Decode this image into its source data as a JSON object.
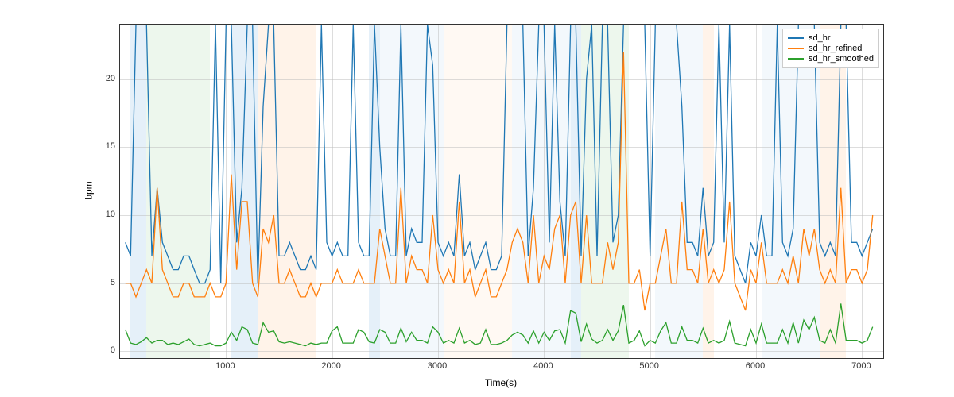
{
  "chart_data": {
    "type": "line",
    "xlabel": "Time(s)",
    "ylabel": "bpm",
    "xlim": [
      0,
      7200
    ],
    "ylim": [
      -0.5,
      24
    ],
    "xticks": [
      1000,
      2000,
      3000,
      4000,
      5000,
      6000,
      7000
    ],
    "yticks": [
      0,
      5,
      10,
      15,
      20
    ],
    "legend": [
      "sd_hr",
      "sd_hr_refined",
      "sd_hr_smoothed"
    ],
    "colors": {
      "sd_hr": "#1f77b4",
      "sd_hr_refined": "#ff7f0e",
      "sd_hr_smoothed": "#2ca02c"
    },
    "bands": [
      {
        "x0": 100,
        "x1": 250,
        "color": "#99c2e6"
      },
      {
        "x0": 250,
        "x1": 850,
        "color": "#b8e0b8"
      },
      {
        "x0": 1050,
        "x1": 1300,
        "color": "#99c2e6"
      },
      {
        "x0": 1300,
        "x1": 1850,
        "color": "#ffd0a8"
      },
      {
        "x0": 2350,
        "x1": 2450,
        "color": "#99c2e6"
      },
      {
        "x0": 2450,
        "x1": 3050,
        "color": "#cfe3f5"
      },
      {
        "x0": 3050,
        "x1": 3700,
        "color": "#ffe6d0"
      },
      {
        "x0": 3700,
        "x1": 4250,
        "color": "#cfe3f5"
      },
      {
        "x0": 4250,
        "x1": 4350,
        "color": "#99c2e6"
      },
      {
        "x0": 4350,
        "x1": 4800,
        "color": "#b8e0b8"
      },
      {
        "x0": 5050,
        "x1": 5500,
        "color": "#cfe3f5"
      },
      {
        "x0": 5500,
        "x1": 5600,
        "color": "#ffd0a8"
      },
      {
        "x0": 6050,
        "x1": 6600,
        "color": "#cfe3f5"
      },
      {
        "x0": 6600,
        "x1": 6850,
        "color": "#ffd0a8"
      }
    ],
    "series": [
      {
        "name": "sd_hr",
        "x": [
          50,
          100,
          150,
          200,
          250,
          300,
          350,
          400,
          450,
          500,
          550,
          600,
          650,
          700,
          750,
          800,
          850,
          900,
          950,
          1000,
          1050,
          1100,
          1150,
          1200,
          1250,
          1300,
          1350,
          1400,
          1450,
          1500,
          1550,
          1600,
          1650,
          1700,
          1750,
          1800,
          1850,
          1900,
          1950,
          2000,
          2050,
          2100,
          2150,
          2200,
          2250,
          2300,
          2350,
          2400,
          2450,
          2500,
          2550,
          2600,
          2650,
          2700,
          2750,
          2800,
          2850,
          2900,
          2950,
          3000,
          3050,
          3100,
          3150,
          3200,
          3250,
          3300,
          3350,
          3400,
          3450,
          3500,
          3550,
          3600,
          3650,
          3700,
          3750,
          3800,
          3850,
          3900,
          3950,
          4000,
          4050,
          4100,
          4150,
          4200,
          4250,
          4300,
          4350,
          4400,
          4450,
          4500,
          4550,
          4600,
          4650,
          4700,
          4750,
          4800,
          4850,
          4900,
          4950,
          5000,
          5050,
          5100,
          5150,
          5200,
          5250,
          5300,
          5350,
          5400,
          5450,
          5500,
          5550,
          5600,
          5650,
          5700,
          5750,
          5800,
          5850,
          5900,
          5950,
          6000,
          6050,
          6100,
          6150,
          6200,
          6250,
          6300,
          6350,
          6400,
          6450,
          6500,
          6550,
          6600,
          6650,
          6700,
          6750,
          6800,
          6850,
          6900,
          6950,
          7000,
          7050,
          7100
        ],
        "y": [
          8,
          7,
          24,
          24,
          24,
          7,
          12,
          8,
          7,
          6,
          6,
          7,
          7,
          6,
          5,
          5,
          6,
          24,
          5,
          24,
          24,
          8,
          12,
          24,
          24,
          5,
          18,
          24,
          24,
          7,
          7,
          8,
          7,
          6,
          6,
          7,
          6,
          24,
          8,
          7,
          8,
          7,
          7,
          24,
          8,
          7,
          7,
          24,
          15,
          9,
          7,
          7,
          24,
          7,
          9,
          8,
          8,
          24,
          21,
          8,
          7,
          8,
          7,
          13,
          7,
          8,
          6,
          7,
          8,
          6,
          6,
          7,
          24,
          24,
          24,
          24,
          7,
          12,
          24,
          24,
          8,
          24,
          11,
          7,
          24,
          24,
          7,
          20,
          24,
          7,
          24,
          24,
          8,
          10,
          24,
          24,
          24,
          24,
          24,
          7,
          24,
          24,
          24,
          24,
          24,
          18,
          8,
          8,
          7,
          12,
          7,
          8,
          24,
          8,
          24,
          7,
          6,
          5,
          8,
          7,
          10,
          7,
          7,
          24,
          8,
          7,
          9,
          24,
          24,
          24,
          24,
          8,
          7,
          8,
          7,
          24,
          24,
          8,
          8,
          7,
          8,
          9
        ]
      },
      {
        "name": "sd_hr_refined",
        "x": [
          50,
          100,
          150,
          200,
          250,
          300,
          350,
          400,
          450,
          500,
          550,
          600,
          650,
          700,
          750,
          800,
          850,
          900,
          950,
          1000,
          1050,
          1100,
          1150,
          1200,
          1250,
          1300,
          1350,
          1400,
          1450,
          1500,
          1550,
          1600,
          1650,
          1700,
          1750,
          1800,
          1850,
          1900,
          1950,
          2000,
          2050,
          2100,
          2150,
          2200,
          2250,
          2300,
          2350,
          2400,
          2450,
          2500,
          2550,
          2600,
          2650,
          2700,
          2750,
          2800,
          2850,
          2900,
          2950,
          3000,
          3050,
          3100,
          3150,
          3200,
          3250,
          3300,
          3350,
          3400,
          3450,
          3500,
          3550,
          3600,
          3650,
          3700,
          3750,
          3800,
          3850,
          3900,
          3950,
          4000,
          4050,
          4100,
          4150,
          4200,
          4250,
          4300,
          4350,
          4400,
          4450,
          4500,
          4550,
          4600,
          4650,
          4700,
          4750,
          4800,
          4850,
          4900,
          4950,
          5000,
          5050,
          5100,
          5150,
          5200,
          5250,
          5300,
          5350,
          5400,
          5450,
          5500,
          5550,
          5600,
          5650,
          5700,
          5750,
          5800,
          5850,
          5900,
          5950,
          6000,
          6050,
          6100,
          6150,
          6200,
          6250,
          6300,
          6350,
          6400,
          6450,
          6500,
          6550,
          6600,
          6650,
          6700,
          6750,
          6800,
          6850,
          6900,
          6950,
          7000,
          7050,
          7100
        ],
        "y": [
          5,
          5,
          4,
          5,
          6,
          5,
          12,
          6,
          5,
          4,
          4,
          5,
          5,
          4,
          4,
          4,
          5,
          4,
          4,
          5,
          13,
          6,
          11,
          11,
          5,
          4,
          9,
          8,
          10,
          5,
          5,
          6,
          5,
          4,
          4,
          5,
          4,
          5,
          5,
          5,
          6,
          5,
          5,
          5,
          6,
          5,
          5,
          5,
          9,
          7,
          5,
          5,
          12,
          5,
          7,
          6,
          6,
          5,
          10,
          6,
          5,
          6,
          5,
          11,
          5,
          6,
          4,
          5,
          6,
          4,
          4,
          5,
          6,
          8,
          9,
          8,
          5,
          10,
          5,
          7,
          6,
          9,
          10,
          5,
          10,
          11,
          5,
          10,
          5,
          5,
          5,
          8,
          6,
          8,
          22,
          5,
          5,
          6,
          3,
          5,
          5,
          7,
          9,
          5,
          5,
          11,
          6,
          6,
          5,
          9,
          5,
          6,
          5,
          6,
          11,
          5,
          4,
          3,
          6,
          5,
          8,
          5,
          5,
          5,
          6,
          5,
          7,
          5,
          9,
          7,
          9,
          6,
          5,
          6,
          5,
          12,
          5,
          6,
          6,
          5,
          6,
          10
        ]
      },
      {
        "name": "sd_hr_smoothed",
        "x": [
          50,
          100,
          150,
          200,
          250,
          300,
          350,
          400,
          450,
          500,
          550,
          600,
          650,
          700,
          750,
          800,
          850,
          900,
          950,
          1000,
          1050,
          1100,
          1150,
          1200,
          1250,
          1300,
          1350,
          1400,
          1450,
          1500,
          1550,
          1600,
          1650,
          1700,
          1750,
          1800,
          1850,
          1900,
          1950,
          2000,
          2050,
          2100,
          2150,
          2200,
          2250,
          2300,
          2350,
          2400,
          2450,
          2500,
          2550,
          2600,
          2650,
          2700,
          2750,
          2800,
          2850,
          2900,
          2950,
          3000,
          3050,
          3100,
          3150,
          3200,
          3250,
          3300,
          3350,
          3400,
          3450,
          3500,
          3550,
          3600,
          3650,
          3700,
          3750,
          3800,
          3850,
          3900,
          3950,
          4000,
          4050,
          4100,
          4150,
          4200,
          4250,
          4300,
          4350,
          4400,
          4450,
          4500,
          4550,
          4600,
          4650,
          4700,
          4750,
          4800,
          4850,
          4900,
          4950,
          5000,
          5050,
          5100,
          5150,
          5200,
          5250,
          5300,
          5350,
          5400,
          5450,
          5500,
          5550,
          5600,
          5650,
          5700,
          5750,
          5800,
          5850,
          5900,
          5950,
          6000,
          6050,
          6100,
          6150,
          6200,
          6250,
          6300,
          6350,
          6400,
          6450,
          6500,
          6550,
          6600,
          6650,
          6700,
          6750,
          6800,
          6850,
          6900,
          6950,
          7000,
          7050,
          7100
        ],
        "y": [
          1.6,
          0.6,
          0.5,
          0.7,
          1.0,
          0.6,
          0.8,
          0.8,
          0.5,
          0.6,
          0.5,
          0.7,
          0.9,
          0.5,
          0.4,
          0.5,
          0.6,
          0.4,
          0.4,
          0.6,
          1.4,
          0.8,
          1.8,
          1.6,
          0.6,
          0.5,
          2.1,
          1.4,
          1.5,
          0.7,
          0.6,
          0.7,
          0.6,
          0.5,
          0.4,
          0.6,
          0.5,
          0.6,
          0.6,
          1.5,
          1.8,
          0.6,
          0.6,
          0.6,
          1.6,
          1.4,
          0.7,
          0.6,
          1.6,
          1.4,
          0.6,
          0.6,
          1.7,
          0.7,
          1.4,
          0.8,
          0.8,
          0.6,
          1.8,
          1.4,
          0.6,
          0.8,
          0.6,
          1.7,
          0.6,
          0.8,
          0.5,
          0.6,
          1.6,
          0.5,
          0.5,
          0.6,
          0.8,
          1.2,
          1.4,
          1.2,
          0.6,
          1.5,
          0.6,
          1.4,
          0.8,
          1.5,
          1.6,
          0.6,
          3.0,
          2.8,
          0.7,
          2.0,
          0.9,
          0.6,
          0.8,
          1.6,
          0.8,
          1.5,
          3.4,
          0.6,
          0.8,
          1.5,
          0.4,
          0.8,
          0.6,
          1.5,
          2.1,
          0.6,
          0.6,
          1.8,
          0.8,
          0.8,
          0.6,
          1.7,
          0.6,
          0.8,
          0.6,
          0.8,
          2.2,
          0.6,
          0.5,
          0.4,
          1.6,
          0.6,
          2.0,
          0.6,
          0.6,
          0.6,
          1.6,
          0.6,
          2.1,
          0.6,
          2.3,
          1.6,
          2.5,
          0.8,
          0.6,
          1.6,
          0.6,
          3.5,
          0.8,
          0.8,
          0.8,
          0.6,
          0.8,
          1.8
        ]
      }
    ]
  }
}
